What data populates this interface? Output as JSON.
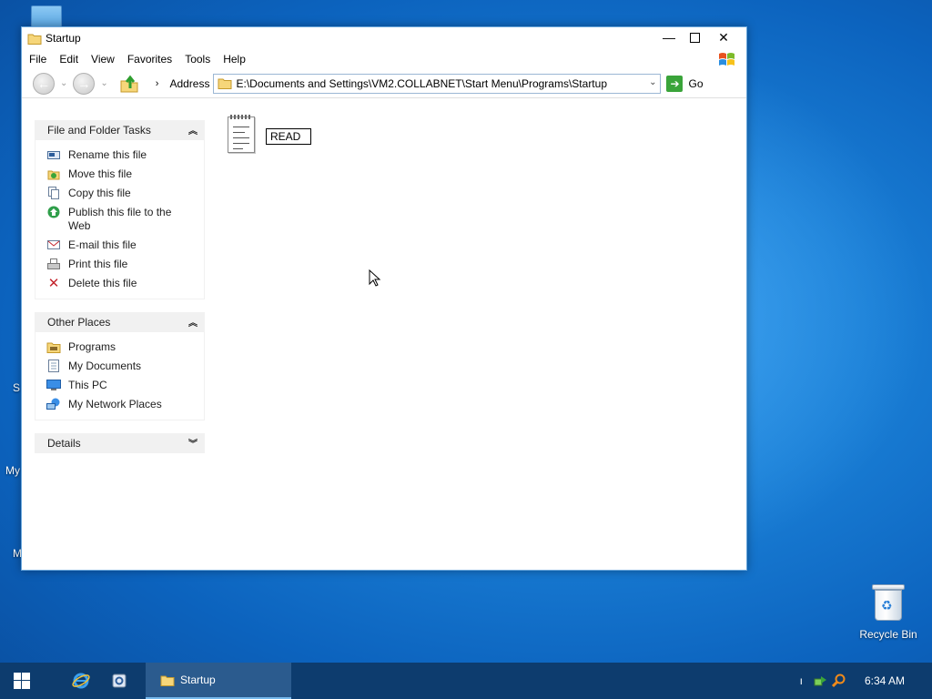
{
  "desktop": {
    "edge_labels": [
      "S",
      "My",
      "M"
    ],
    "recycle_bin_label": "Recycle Bin"
  },
  "window": {
    "title": "Startup",
    "controls": {
      "minimize": "—",
      "maximize": "☐",
      "close": "✕"
    },
    "menu": [
      "File",
      "Edit",
      "View",
      "Favorites",
      "Tools",
      "Help"
    ],
    "toolbar": {
      "address_label": "Address",
      "address_value": "E:\\Documents and Settings\\VM2.COLLABNET\\Start Menu\\Programs\\Startup",
      "go_label": "Go"
    },
    "sidebar": {
      "file_tasks": {
        "title": "File and Folder Tasks",
        "items": [
          {
            "label": "Rename this file",
            "icon": "rename-icon"
          },
          {
            "label": "Move this file",
            "icon": "move-icon"
          },
          {
            "label": "Copy this file",
            "icon": "copy-icon"
          },
          {
            "label": "Publish this file to the Web",
            "icon": "publish-web-icon"
          },
          {
            "label": "E-mail this file",
            "icon": "email-icon"
          },
          {
            "label": "Print this file",
            "icon": "print-icon"
          },
          {
            "label": "Delete this file",
            "icon": "delete-icon"
          }
        ]
      },
      "other_places": {
        "title": "Other Places",
        "items": [
          {
            "label": "Programs",
            "icon": "folder-icon"
          },
          {
            "label": "My Documents",
            "icon": "documents-icon"
          },
          {
            "label": "This PC",
            "icon": "computer-icon"
          },
          {
            "label": "My Network Places",
            "icon": "network-icon"
          }
        ]
      },
      "details": {
        "title": "Details"
      }
    },
    "files": [
      {
        "name": "READ",
        "icon": "notepad-file-icon",
        "renaming": true
      }
    ]
  },
  "taskbar": {
    "active_window": "Startup",
    "clock": "6:34 AM",
    "tray_marker": "ı"
  },
  "colors": {
    "taskbar_bg": "#0d3c6e",
    "active_task_bg": "#2b5b8e",
    "panel_header_bg": "#f1f1f1",
    "go_green": "#3aa43a",
    "delete_red": "#c4262e"
  }
}
